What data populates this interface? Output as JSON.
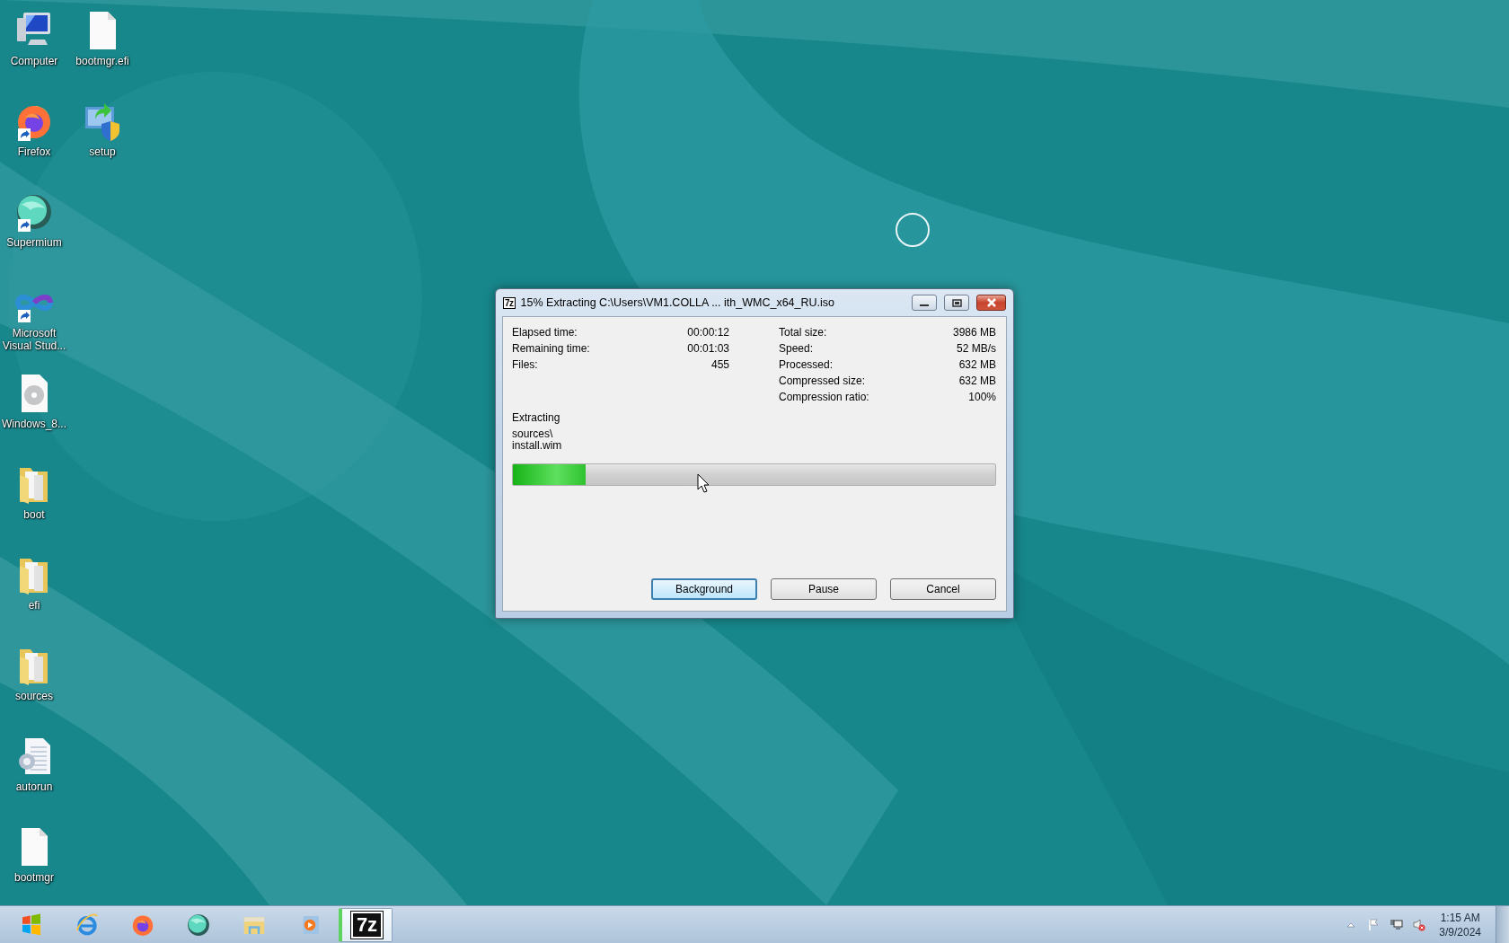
{
  "desktop": {
    "columns": [
      [
        {
          "label": "Computer",
          "kind": "computer",
          "shortcut": false
        },
        {
          "label": "Firefox",
          "kind": "firefox",
          "shortcut": true
        },
        {
          "label": "Supermium",
          "kind": "supermium",
          "shortcut": true
        },
        {
          "label": "Microsoft Visual Stud...",
          "kind": "visualstudio",
          "shortcut": true
        },
        {
          "label": "Windows_8...",
          "kind": "disc",
          "shortcut": false
        },
        {
          "label": "boot",
          "kind": "folder",
          "shortcut": false
        },
        {
          "label": "efi",
          "kind": "folder",
          "shortcut": false
        },
        {
          "label": "sources",
          "kind": "folder",
          "shortcut": false
        },
        {
          "label": "autorun",
          "kind": "settings",
          "shortcut": false
        },
        {
          "label": "bootmgr",
          "kind": "file",
          "shortcut": false
        }
      ],
      [
        {
          "label": "bootmgr.efi",
          "kind": "file",
          "shortcut": false
        },
        {
          "label": "setup",
          "kind": "setup",
          "shortcut": false
        }
      ]
    ]
  },
  "dialog": {
    "app_icon_text": "7z",
    "title": "15% Extracting C:\\Users\\VM1.COLLA ... ith_WMC_x64_RU.iso",
    "window_controls": [
      {
        "kind": "minimize"
      },
      {
        "kind": "maximize"
      },
      {
        "kind": "close"
      }
    ],
    "stats_left": [
      {
        "label": "Elapsed time:",
        "value": "00:00:12"
      },
      {
        "label": "Remaining time:",
        "value": "00:01:03"
      },
      {
        "label": "Files:",
        "value": "455"
      }
    ],
    "stats_right": [
      {
        "label": "Total size:",
        "value": "3986 MB"
      },
      {
        "label": "Speed:",
        "value": "52 MB/s"
      },
      {
        "label": "Processed:",
        "value": "632 MB"
      },
      {
        "label": "Compressed size:",
        "value": "632 MB"
      },
      {
        "label": "Compression ratio:",
        "value": "100%"
      }
    ],
    "status": "Extracting",
    "current_path": [
      "sources\\",
      "install.wim"
    ],
    "progress": {
      "level": 0.15
    },
    "buttons": [
      {
        "label": "Background",
        "focused": true
      },
      {
        "label": "Pause",
        "focused": false
      },
      {
        "label": "Cancel",
        "focused": false
      }
    ]
  },
  "taskbar": {
    "apps": [
      {
        "kind": "start",
        "selected": false
      },
      {
        "kind": "ie",
        "selected": false
      },
      {
        "kind": "firefox",
        "selected": false
      },
      {
        "kind": "supermium",
        "selected": false
      },
      {
        "kind": "explorer",
        "selected": false
      },
      {
        "kind": "media",
        "selected": false
      },
      {
        "kind": "sevenzip",
        "logo_text": "7z",
        "selected": true
      }
    ],
    "tray": [
      {
        "kind": "chevron"
      },
      {
        "kind": "flag"
      },
      {
        "kind": "network"
      },
      {
        "kind": "volume-muted"
      }
    ],
    "clock": {
      "time": "1:15 AM",
      "date": "3/9/2024"
    }
  }
}
